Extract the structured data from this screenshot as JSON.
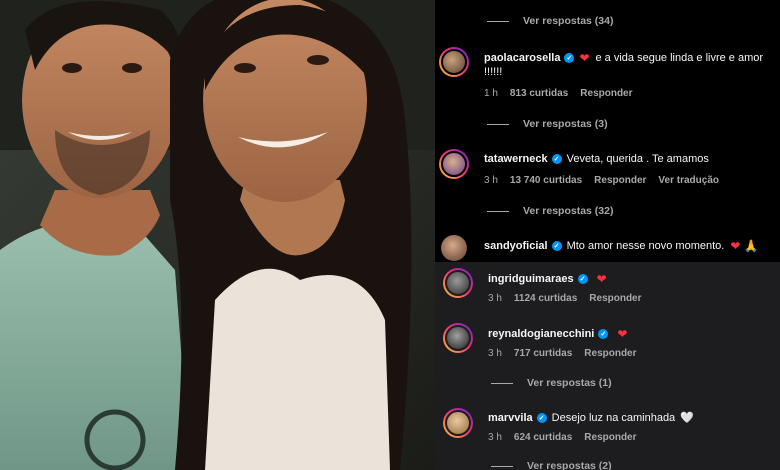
{
  "comments_panel": {
    "top_replies": "Ver respostas (34)",
    "comments": [
      {
        "user": "paolacarosella",
        "text": "e a vida segue linda e livre e amor",
        "text_cont": "!!!!!!",
        "emoji": "❤",
        "time": "1 h",
        "likes": "813 curtidas",
        "reply": "Responder",
        "view_replies": "Ver respostas (3)"
      },
      {
        "user": "tatawerneck",
        "text": "Veveta, querida . Te amamos",
        "time": "3 h",
        "likes": "13 740 curtidas",
        "reply": "Responder",
        "translate": "Ver tradução",
        "view_replies": "Ver respostas (32)"
      },
      {
        "user": "sandyoficial",
        "text": "Mto amor nesse novo momento.",
        "emoji": "❤ 🙏"
      }
    ],
    "overlay_comments": [
      {
        "user": "ingridguimaraes",
        "emoji": "❤",
        "time": "3 h",
        "likes": "1124 curtidas",
        "reply": "Responder"
      },
      {
        "user": "reynaldogianecchini",
        "emoji": "❤",
        "time": "3 h",
        "likes": "717 curtidas",
        "reply": "Responder",
        "view_replies": "Ver respostas (1)"
      },
      {
        "user": "marvvila",
        "text": "Desejo luz na caminhada",
        "emoji": "🤍",
        "time": "3 h",
        "likes": "624 curtidas",
        "reply": "Responder",
        "view_replies": "Ver respostas (2)"
      }
    ]
  },
  "colors": {
    "background": "#000000",
    "overlay_background": "#1d1d1f",
    "verified": "#0095f6",
    "heart": "#ff3040",
    "muted": "#a8a8a8"
  }
}
